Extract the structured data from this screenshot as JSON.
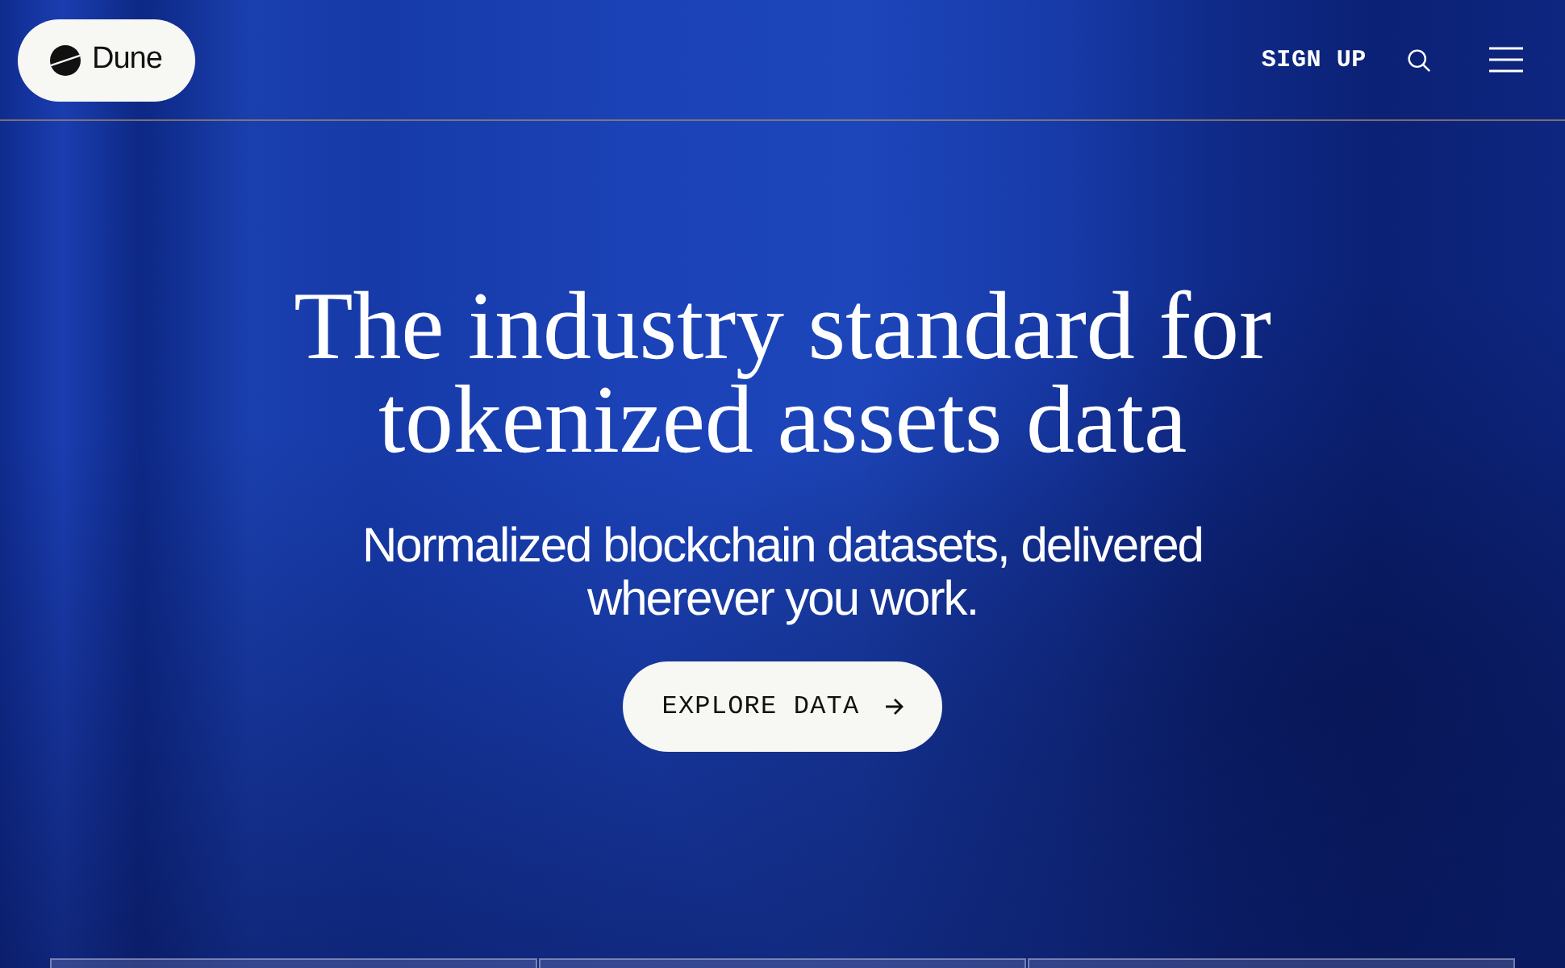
{
  "header": {
    "logo": {
      "text": "Dune"
    },
    "sign_up": "SIGN UP"
  },
  "hero": {
    "title": "The industry standard for tokenized assets data",
    "subtitle": "Normalized blockchain datasets, delivered wherever you work.",
    "cta": {
      "label": "EXPLORE DATA"
    }
  }
}
